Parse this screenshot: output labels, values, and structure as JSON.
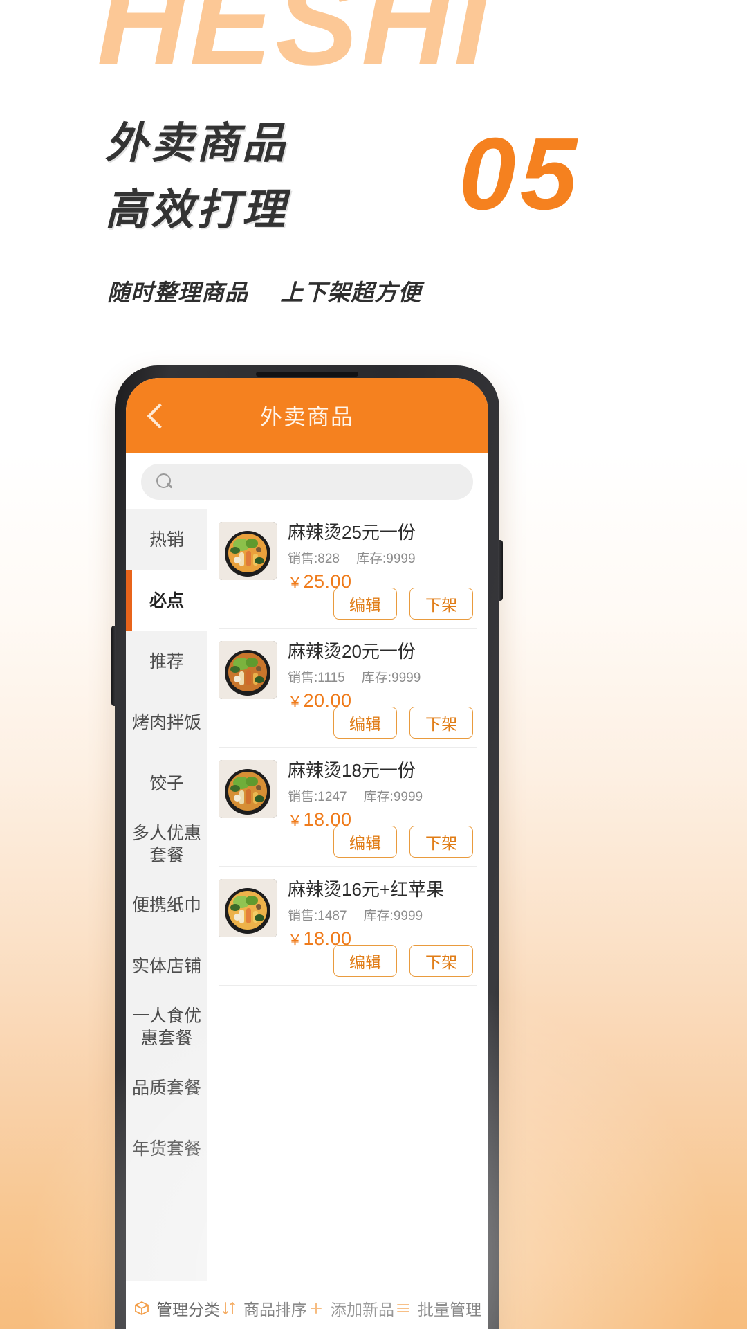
{
  "poster": {
    "watermark": "HESHI",
    "headline_line1": "外卖商品",
    "headline_line2": "高效打理",
    "subtitle_left": "随时整理商品",
    "subtitle_right": "上下架超方便",
    "big_number": "05",
    "accent_color": "#f5811f",
    "watermark_color": "#fcc896",
    "headline_color": "#333333"
  },
  "app": {
    "header": {
      "back_icon": "chevron-left-icon",
      "title": "外卖商品"
    },
    "search": {
      "icon": "search-icon",
      "value": "",
      "placeholder": ""
    },
    "sidebar": {
      "active_index": 1,
      "items": [
        {
          "label": "热销"
        },
        {
          "label": "必点"
        },
        {
          "label": "推荐"
        },
        {
          "label": "烤肉拌饭"
        },
        {
          "label": "饺子"
        },
        {
          "label": "多人优惠套餐"
        },
        {
          "label": "便携纸巾"
        },
        {
          "label": "实体店铺"
        },
        {
          "label": "一人食优惠套餐"
        },
        {
          "label": "品质套餐"
        },
        {
          "label": "年货套餐"
        }
      ]
    },
    "product_labels": {
      "sales_prefix": "销售:",
      "stock_prefix": "库存:",
      "currency": "￥",
      "edit": "编辑",
      "offshelf": "下架"
    },
    "products": [
      {
        "name": "麻辣烫25元一份",
        "sales": "828",
        "stock": "9999",
        "price": "25.00",
        "thumb": "hotpot-bowl-1"
      },
      {
        "name": "麻辣烫20元一份",
        "sales": "1115",
        "stock": "9999",
        "price": "20.00",
        "thumb": "hotpot-bowl-2"
      },
      {
        "name": "麻辣烫18元一份",
        "sales": "1247",
        "stock": "9999",
        "price": "18.00",
        "thumb": "hotpot-bowl-3"
      },
      {
        "name": "麻辣烫16元+红苹果",
        "sales": "1487",
        "stock": "9999",
        "price": "18.00",
        "thumb": "hotpot-bowl-4"
      }
    ],
    "toolbar": [
      {
        "icon": "box-icon",
        "label": "管理分类"
      },
      {
        "icon": "sort-icon",
        "label": "商品排序"
      },
      {
        "icon": "plus-icon",
        "label": "添加新品"
      },
      {
        "icon": "list-icon",
        "label": "批量管理"
      }
    ]
  }
}
